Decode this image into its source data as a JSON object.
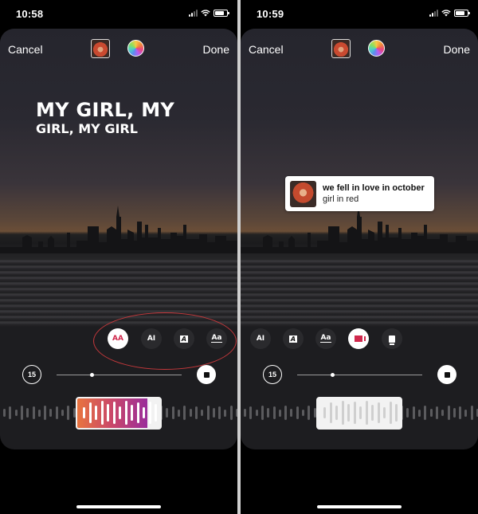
{
  "screens": [
    {
      "status_bar": {
        "time": "10:58"
      },
      "top_bar": {
        "cancel_label": "Cancel",
        "done_label": "Done",
        "album_icon": "album-art-thumbnail",
        "color_icon": "color-wheel-icon"
      },
      "lyrics": {
        "line1": "MY GIRL, MY",
        "line2": "GIRL, MY GIRL"
      },
      "style_options": [
        {
          "name": "lyrics-style",
          "glyph": "AA",
          "active": true
        },
        {
          "name": "typewriter-style",
          "glyph": "AI",
          "active": false
        },
        {
          "name": "boxed-style",
          "glyph": "A",
          "active": false
        },
        {
          "name": "underline-style",
          "glyph": "Aa",
          "active": false
        }
      ],
      "duration_label": "15",
      "playback_progress": 0.28,
      "selection_style": "gradient",
      "annotation": "red ellipse highlighting style options"
    },
    {
      "status_bar": {
        "time": "10:59"
      },
      "top_bar": {
        "cancel_label": "Cancel",
        "done_label": "Done",
        "album_icon": "album-art-thumbnail",
        "color_icon": "color-wheel-icon"
      },
      "sticker": {
        "song_title": "we fell in love in october",
        "artist": "girl in red"
      },
      "style_options": [
        {
          "name": "typewriter-style",
          "glyph": "AI",
          "active": false
        },
        {
          "name": "boxed-style",
          "glyph": "A",
          "active": false
        },
        {
          "name": "underline-style",
          "glyph": "Aa",
          "active": false
        },
        {
          "name": "video-sticker-style",
          "glyph": "video",
          "active": true
        },
        {
          "name": "card-sticker-style",
          "glyph": "card",
          "active": false
        }
      ],
      "duration_label": "15",
      "playback_progress": 0.28,
      "selection_style": "white"
    }
  ],
  "colors": {
    "accent": "#d0284c",
    "highlight_ellipse": "#c8393c",
    "gradient_start": "#e8743f",
    "gradient_end": "#9a2d9a"
  }
}
